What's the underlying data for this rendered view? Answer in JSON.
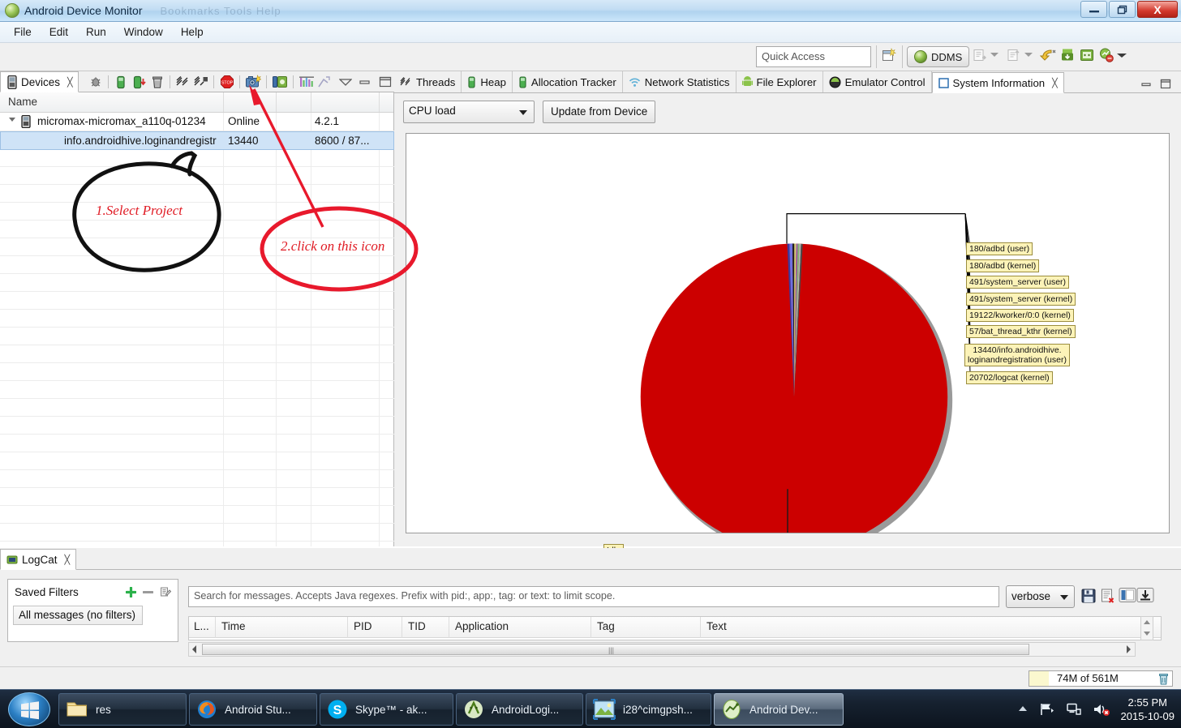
{
  "window": {
    "title": "Android Device Monitor",
    "ghost_text": "Bookmarks  Tools  Help",
    "minimize": "–",
    "restore": "❐",
    "close": "X"
  },
  "menubar": {
    "items": [
      "File",
      "Edit",
      "Run",
      "Window",
      "Help"
    ]
  },
  "toolbar": {
    "quick_access_placeholder": "Quick Access",
    "perspective_label": "DDMS",
    "icons": [
      "new-perspective-icon",
      "open-perspective-icon",
      "import-icon",
      "import-dropdown-icon",
      "export-icon",
      "export-dropdown-icon",
      "back-icon",
      "android-download-icon",
      "android-sdk-icon",
      "avd-manager-icon",
      "toolbar-dropdown-icon"
    ]
  },
  "devices_panel": {
    "tab_label": "Devices",
    "tab_icon": "device-icon",
    "close_icon": "close-icon",
    "toolbar_icons": [
      "debug-icon",
      "heap-update-icon",
      "heap-dump-icon",
      "gc-icon",
      "threads-start-icon",
      "threads-stop-icon",
      "stop-process-icon",
      "screen-capture-icon",
      "device-capture-icon",
      "method-profiling-icon",
      "tracing-icon",
      "view-menu-icon",
      "minimize-icon",
      "maximize-icon"
    ],
    "columns": [
      "Name",
      "",
      "",
      ""
    ],
    "rows": [
      {
        "name": "micromax-micromax_a110q-01234",
        "status": "Online",
        "version": "4.2.1",
        "extra": "",
        "type": "device",
        "expanded": true
      },
      {
        "name": "info.androidhive.loginandregistr",
        "status": "13440",
        "version": "8600 / 87...",
        "extra": "",
        "type": "process",
        "selected": true
      }
    ]
  },
  "annotations": [
    {
      "id": "callout-1",
      "text": "1.Select Project",
      "color": "#e01b24",
      "shape": "speech-bubble",
      "stroke": "#000000"
    },
    {
      "id": "callout-2",
      "text": "2.click on this icon",
      "color": "#e01b24",
      "shape": "ellipse",
      "stroke": "#e8192c"
    }
  ],
  "right_panel": {
    "tabs": [
      {
        "label": "Threads",
        "icon": "threads-icon",
        "active": false
      },
      {
        "label": "Heap",
        "icon": "heap-icon",
        "active": false
      },
      {
        "label": "Allocation Tracker",
        "icon": "allocation-icon",
        "active": false
      },
      {
        "label": "Network Statistics",
        "icon": "network-icon",
        "active": false
      },
      {
        "label": "File Explorer",
        "icon": "android-file-icon",
        "active": false
      },
      {
        "label": "Emulator Control",
        "icon": "emulator-icon",
        "active": false
      },
      {
        "label": "System Information",
        "icon": "sysinfo-icon",
        "active": true
      }
    ],
    "close_icon": "close-icon",
    "minimize_icon": "minimize-icon",
    "maximize_icon": "maximize-icon",
    "selector_value": "CPU load",
    "update_button": "Update from Device"
  },
  "chart_data": {
    "type": "pie",
    "title": "CPU load",
    "legend": "labels-on-chart",
    "labels": [
      "180/adbd (user)",
      "180/adbd (kernel)",
      "491/system_server (user)",
      "491/system_server (kernel)",
      "19122/kworker/0:0 (kernel)",
      "57/bat_thread_kthr (kernel)",
      "13440/info.androidhive. loginandregistration (user)",
      "20702/logcat (kernel)",
      "Idle"
    ],
    "values": [
      0.55,
      0.45,
      0.4,
      0.35,
      0.3,
      0.28,
      0.25,
      0.22,
      96.7
    ],
    "colors": [
      "#3a3a9e",
      "#6f6fe0",
      "#2f2f2f",
      "#c8c86a",
      "#9e5ea8",
      "#6fb36f",
      "#b0b0b0",
      "#555555",
      "#cc0000"
    ],
    "multi_label_box": [
      "180/adbd (user)",
      "180/adbd (kernel)",
      "491/system_server (user)",
      "491/system_server (kernel)",
      "19122/kworker/0:0 (kernel)",
      "57/bat_thread_kthr (kernel)",
      "13440/info.androidhive.",
      "loginandregistration (user)",
      "20702/logcat (kernel)"
    ],
    "idle_label": "Idle"
  },
  "logcat": {
    "tab_label": "LogCat",
    "tab_icon": "logcat-icon",
    "close_icon": "close-icon",
    "saved_filters_title": "Saved Filters",
    "add_icon": "plus-icon",
    "remove_icon": "minus-icon",
    "edit_icon": "edit-icon",
    "filters": [
      "All messages (no filters)"
    ],
    "search_placeholder": "Search for messages. Accepts Java regexes. Prefix with pid:, app:, tag: or text: to limit scope.",
    "log_level": "verbose",
    "toolbar_icons": [
      "save-icon",
      "clear-log-icon",
      "display-mode-icon",
      "scroll-lock-icon"
    ],
    "columns": [
      "L...",
      "Time",
      "PID",
      "TID",
      "Application",
      "Tag",
      "Text"
    ],
    "rows": []
  },
  "statusbar": {
    "heap_label": "74M of 561M",
    "trash_icon": "trash-icon"
  },
  "taskbar": {
    "start_icon": "windows-start-icon",
    "buttons": [
      {
        "label": "res",
        "icon": "folder-icon",
        "active": false
      },
      {
        "label": "Android Stu...",
        "icon": "firefox-icon",
        "active": false
      },
      {
        "label": "Skype™ - ak...",
        "icon": "skype-icon",
        "active": false
      },
      {
        "label": "AndroidLogi...",
        "icon": "android-studio-icon",
        "active": false
      },
      {
        "label": "i28^cimgpsh...",
        "icon": "image-icon",
        "active": false
      },
      {
        "label": "Android Dev...",
        "icon": "device-monitor-icon",
        "active": true
      }
    ],
    "tray_icons": [
      "show-hidden-icons-icon",
      "action-center-flag-icon",
      "network-icon",
      "volume-muted-icon"
    ],
    "clock_time": "2:55 PM",
    "clock_date": "2015-10-09"
  }
}
